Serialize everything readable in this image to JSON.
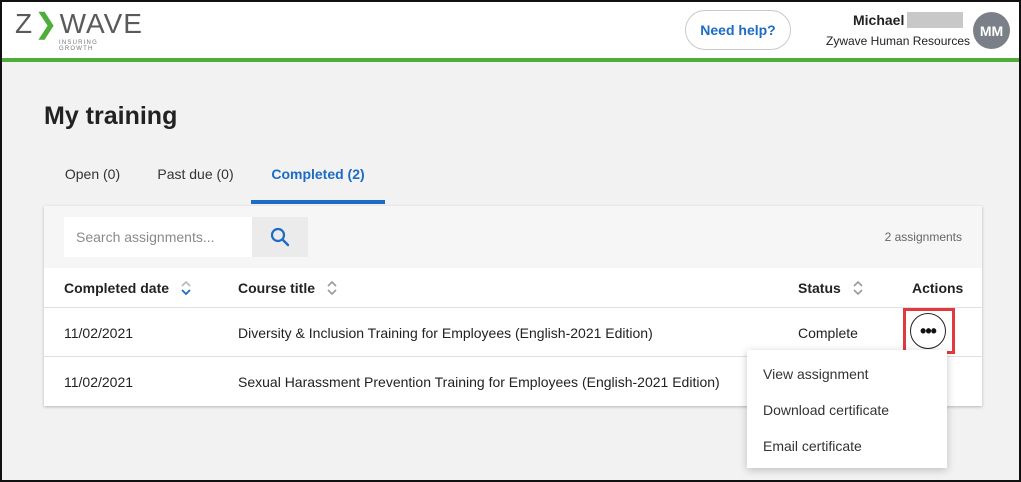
{
  "header": {
    "logo_text_left": "Z",
    "logo_text_right": "WAVE",
    "logo_tagline": "INSURING GROWTH",
    "help_label": "Need help?",
    "user_first_name": "Michael",
    "user_org": "Zywave Human Resources",
    "avatar_initials": "MM",
    "accent_color": "#4fae3a"
  },
  "page": {
    "title": "My training",
    "tabs": [
      {
        "label": "Open (0)",
        "active": false
      },
      {
        "label": "Past due (0)",
        "active": false
      },
      {
        "label": "Completed (2)",
        "active": true
      }
    ]
  },
  "toolbar": {
    "search_placeholder": "Search assignments...",
    "search_value": "",
    "assignment_count": "2 assignments"
  },
  "table": {
    "columns": [
      {
        "label": "Completed date",
        "sortable": true,
        "sort_state": "active"
      },
      {
        "label": "Course title",
        "sortable": true,
        "sort_state": "none"
      },
      {
        "label": "Status",
        "sortable": true,
        "sort_state": "none"
      },
      {
        "label": "Actions",
        "sortable": false
      }
    ],
    "rows": [
      {
        "completed_date": "11/02/2021",
        "course_title": "Diversity & Inclusion Training for Employees (English-2021 Edition)",
        "status": "Complete"
      },
      {
        "completed_date": "11/02/2021",
        "course_title": "Sexual Harassment Prevention Training for Employees (English-2021 Edition)",
        "status": ""
      }
    ],
    "more_actions_glyph": "•••"
  },
  "actions_menu": {
    "items": [
      "View assignment",
      "Download certificate",
      "Email certificate"
    ]
  },
  "colors": {
    "primary_blue": "#1c6cc4",
    "highlight_red": "#e0393e"
  }
}
